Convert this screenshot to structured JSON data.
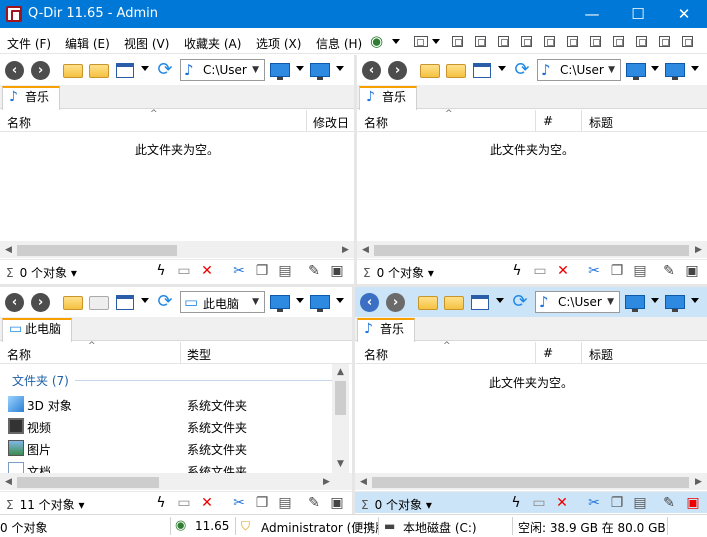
{
  "window": {
    "title": "Q-Dir 11.65 - Admin",
    "minimize": "—",
    "maximize": "☐",
    "close": "✕"
  },
  "menu": [
    {
      "label": "文件 (F)"
    },
    {
      "label": "编辑 (E)"
    },
    {
      "label": "视图 (V)"
    },
    {
      "label": "收藏夹 (A)"
    },
    {
      "label": "选项 (X)"
    },
    {
      "label": "信息 (H)"
    }
  ],
  "panes": {
    "top_left": {
      "path": "C:\\User",
      "tab": "音乐",
      "columns": [
        "名称",
        "修改日"
      ],
      "empty": "此文件夹为空。",
      "count": "0 个对象"
    },
    "top_right": {
      "path": "C:\\User",
      "tab": "音乐",
      "columns": [
        "名称",
        "#",
        "标题"
      ],
      "empty": "此文件夹为空。",
      "count": "0 个对象"
    },
    "bottom_left": {
      "path": "此电脑",
      "tab": "此电脑",
      "columns": [
        "名称",
        "类型"
      ],
      "group": "文件夹 (7)",
      "items": [
        {
          "name": "3D 对象",
          "type": "系统文件夹",
          "icon": "3d-objects-icon"
        },
        {
          "name": "视频",
          "type": "系统文件夹",
          "icon": "video-icon"
        },
        {
          "name": "图片",
          "type": "系统文件夹",
          "icon": "pictures-icon"
        },
        {
          "name": "文档",
          "type": "系统文件夹",
          "icon": "documents-icon"
        }
      ],
      "count": "11 个对象"
    },
    "bottom_right": {
      "path": "C:\\User",
      "tab": "音乐",
      "columns": [
        "名称",
        "#",
        "标题"
      ],
      "empty": "此文件夹为空。",
      "count": "0 个对象"
    }
  },
  "statusbar": {
    "objects": "0 个对象",
    "version": "11.65",
    "user": "Administrator (便携版",
    "drive": "本地磁盘 (C:)",
    "free": "空闲: 38.9 GB 在 80.0 GB"
  },
  "colors": {
    "titlebar": "#0078d7",
    "tab_accent": "#f7a000",
    "active_status": "#cce4f7"
  }
}
